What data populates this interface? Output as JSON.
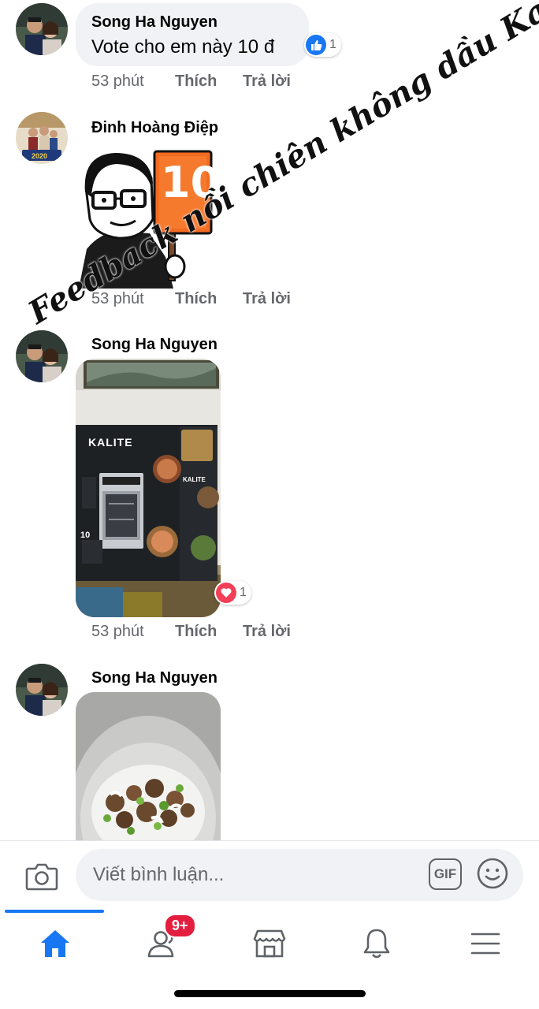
{
  "comments": [
    {
      "author": "Song Ha Nguyen",
      "text": "Vote cho em này 10 đ",
      "reaction_count": "1",
      "reaction_type": "like",
      "time": "53 phút",
      "like_label": "Thích",
      "reply_label": "Trả lời"
    },
    {
      "author": "Đinh Hoàng Điệp",
      "sticker_sign": "10",
      "avatar_caption": "2020",
      "time": "53 phút",
      "like_label": "Thích",
      "reply_label": "Trả lời"
    },
    {
      "author": "Song Ha Nguyen",
      "photo_brand": "KALITE",
      "photo_box_side_brand": "KALITE",
      "photo_box_number": "10",
      "reaction_count": "1",
      "reaction_type": "love",
      "time": "53 phút",
      "like_label": "Thích",
      "reply_label": "Trả lời"
    },
    {
      "author": "Song Ha Nguyen"
    }
  ],
  "watermark": "Feedback nồi chiên không dầu Kalite",
  "composer": {
    "placeholder": "Viết bình luận...",
    "gif_label": "GIF"
  },
  "tabbar": {
    "friends_badge": "9+",
    "active_tab": "home"
  },
  "colors": {
    "accent": "#1877f2",
    "badge": "#e41e3f",
    "love": "#f33e58"
  }
}
